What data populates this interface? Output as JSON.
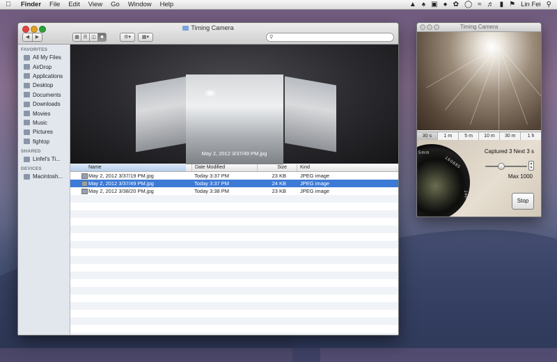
{
  "menubar": {
    "apple_icon": "apple-icon",
    "app_name": "Finder",
    "items": [
      "File",
      "Edit",
      "View",
      "Go",
      "Window",
      "Help"
    ],
    "status_icons": [
      "menu-icon-1",
      "menu-icon-2",
      "menu-icon-3",
      "menu-icon-4",
      "menu-icon-5",
      "menu-icon-6",
      "wifi-icon",
      "volume-icon",
      "battery-icon",
      "flag-icon"
    ],
    "user": "Lin Fei",
    "search_icon": "spotlight-icon"
  },
  "finder": {
    "title": "Timing Camera",
    "search_placeholder": "",
    "sidebar": {
      "favorites_header": "FAVORITES",
      "favorites": [
        "All My Files",
        "AirDrop",
        "Applications",
        "Desktop",
        "Documents",
        "Downloads",
        "Movies",
        "Music",
        "Pictures",
        "fightop"
      ],
      "shared_header": "SHARED",
      "shared": [
        "Linfel's Ti..."
      ],
      "devices_header": "DEVICES",
      "devices": [
        "Macintosh..."
      ]
    },
    "coverflow_caption": "May 2, 2012 3/37/49 PM.jpg",
    "columns": {
      "name": "Name",
      "date": "Date Modified",
      "size": "Size",
      "kind": "Kind"
    },
    "files": [
      {
        "name": "May 2, 2012 3/37/19 PM.jpg",
        "date": "Today 3:37 PM",
        "size": "23 KB",
        "kind": "JPEG image",
        "selected": false
      },
      {
        "name": "May 2, 2012 3/37/49 PM.jpg",
        "date": "Today 3:37 PM",
        "size": "24 KB",
        "kind": "JPEG image",
        "selected": true
      },
      {
        "name": "May 2, 2012 3/38/20 PM.jpg",
        "date": "Today 3:38 PM",
        "size": "23 KB",
        "kind": "JPEG image",
        "selected": false
      }
    ]
  },
  "camera": {
    "title": "Timing Camera",
    "intervals": [
      "30 s",
      "1 m",
      "5 m",
      "10 m",
      "30 m",
      "1 h"
    ],
    "selected_interval": "30 s",
    "status": "Captured 3 Next 3 s",
    "max_label": "Max 1000",
    "slider_fraction": 0.35,
    "lens_text_1": "5mm",
    "lens_text_2": "160885",
    "lens_text_3": "Japan",
    "stop_label": "Stop"
  }
}
